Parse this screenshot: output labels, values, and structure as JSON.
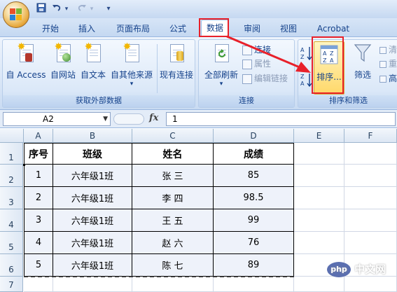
{
  "quick_access": {
    "icons": [
      "save-icon",
      "undo-icon",
      "redo-icon",
      "customize-icon"
    ],
    "customize_glyph": "▾"
  },
  "tabs": [
    {
      "label": "开始"
    },
    {
      "label": "插入"
    },
    {
      "label": "页面布局"
    },
    {
      "label": "公式"
    },
    {
      "label": "数据",
      "active": true
    },
    {
      "label": "审阅"
    },
    {
      "label": "视图"
    },
    {
      "label": "Acrobat"
    }
  ],
  "ribbon": {
    "external": {
      "label": "获取外部数据",
      "buttons": [
        "自 Access",
        "自网站",
        "自文本",
        "自其他来源",
        "现有连接"
      ]
    },
    "connections": {
      "label": "连接",
      "refresh": "全部刷新",
      "small": [
        "连接",
        "属性",
        "编辑链接"
      ]
    },
    "sort_filter": {
      "label": "排序和筛选",
      "sort": "排序...",
      "filter": "筛选",
      "small": [
        "清",
        "重",
        "高"
      ]
    }
  },
  "formula_bar": {
    "name_box": "A2",
    "fx": "fx",
    "value": "1"
  },
  "columns": [
    "A",
    "B",
    "C",
    "D",
    "E",
    "F"
  ],
  "rows": [
    "1",
    "2",
    "3",
    "4",
    "5",
    "6",
    "7"
  ],
  "table": {
    "headers": [
      "序号",
      "班级",
      "姓名",
      "成绩"
    ],
    "rows": [
      [
        "1",
        "六年级1班",
        "张 三",
        "85"
      ],
      [
        "2",
        "六年级1班",
        "李 四",
        "98.5"
      ],
      [
        "3",
        "六年级1班",
        "王 五",
        "99"
      ],
      [
        "4",
        "六年级1班",
        "赵 六",
        "76"
      ],
      [
        "5",
        "六年级1班",
        "陈 七",
        "89"
      ]
    ]
  },
  "colors": {
    "highlight_red": "#e8202a",
    "ribbon_blue": "#15428b",
    "sort_highlight": "#ffe27a"
  }
}
